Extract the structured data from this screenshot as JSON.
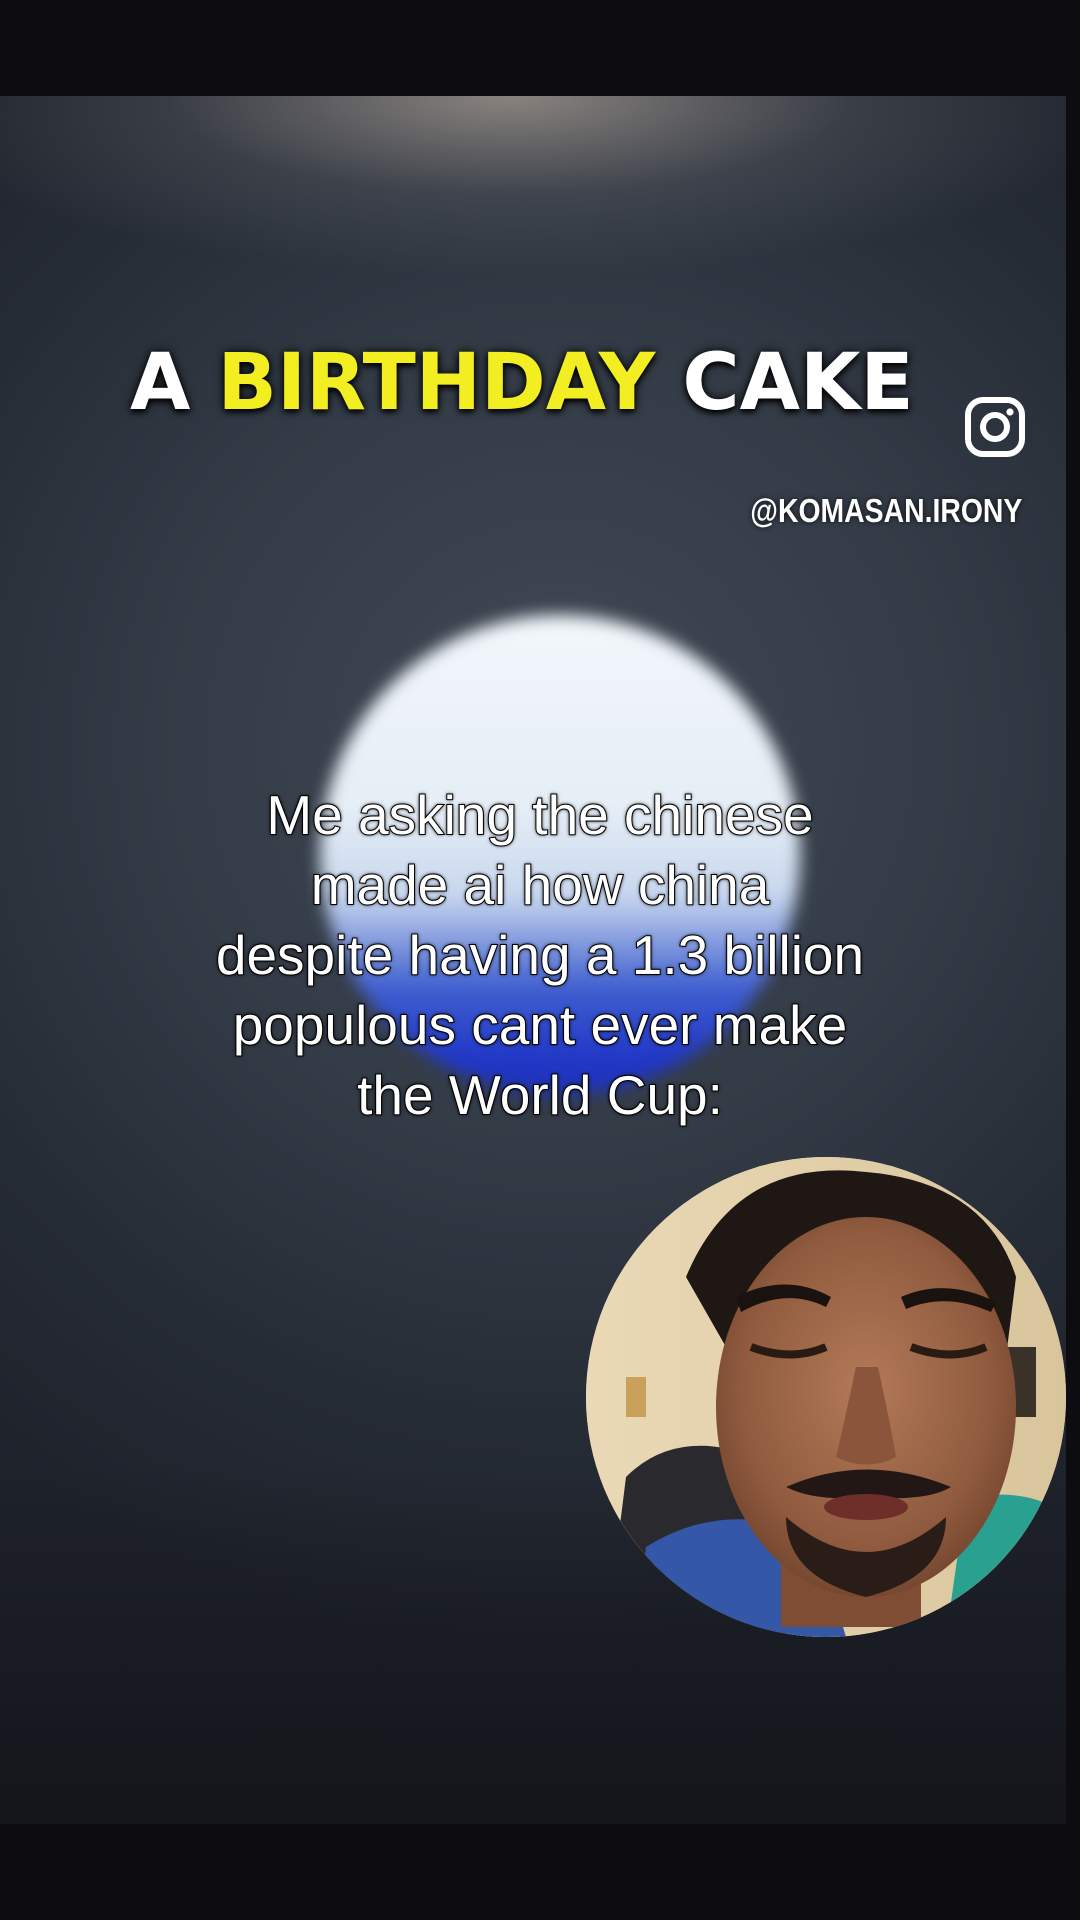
{
  "overlay_title": {
    "word1": "A",
    "word2": "BIRTHDAY",
    "word3": "CAKE"
  },
  "watermark": {
    "handle": "@KOMASAN.IRONY",
    "icon": "instagram-icon"
  },
  "caption": {
    "lines": [
      "Me asking the chinese",
      "made ai how china",
      "despite having a 1.3 billion",
      "populous cant ever make",
      "the World Cup:"
    ]
  },
  "colors": {
    "title_highlight": "#f2ee21",
    "title_text": "#ffffff",
    "caption_text": "#ffffff",
    "glow_blue": "#2238c8"
  },
  "face_cam": {
    "icon": "person-face-avatar"
  }
}
